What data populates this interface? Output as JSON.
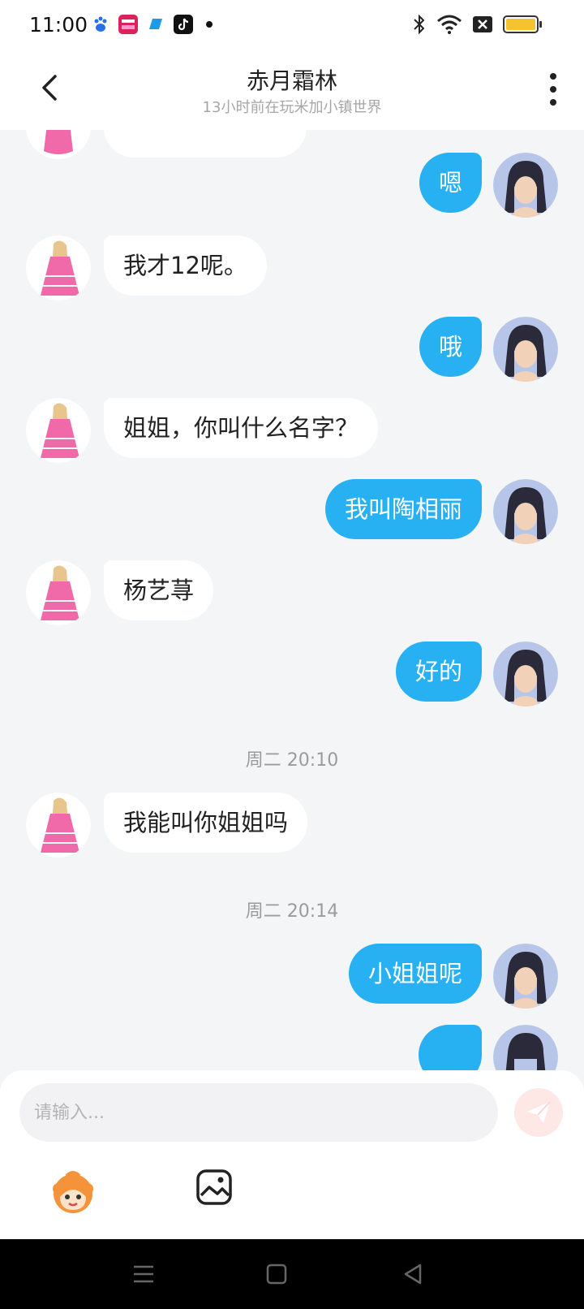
{
  "status_bar": {
    "time": "11:00",
    "app_icons": [
      "baidu-icon",
      "tv-app-icon",
      "blue-app-icon",
      "tiktok-icon"
    ],
    "battery_color": "#f5c330"
  },
  "header": {
    "title": "赤月霜林",
    "subtitle": "13小时前在玩米加小镇世界"
  },
  "messages": [
    {
      "side": "out",
      "text": "嗯"
    },
    {
      "side": "in",
      "text": "我才12呢。"
    },
    {
      "side": "out",
      "text": "哦"
    },
    {
      "side": "in",
      "text": "姐姐，你叫什么名字？"
    },
    {
      "side": "out",
      "text": "我叫陶相丽"
    },
    {
      "side": "in",
      "text": "杨艺荨"
    },
    {
      "side": "out",
      "text": "好的"
    },
    {
      "type": "time",
      "text": "周二 20:10"
    },
    {
      "side": "in",
      "text": "我能叫你姐姐吗"
    },
    {
      "type": "time",
      "text": "周二 20:14"
    },
    {
      "side": "out",
      "text": "小姐姐呢"
    }
  ],
  "input": {
    "placeholder": "请输入..."
  },
  "colors": {
    "outgoing_bubble": "#27b0f2",
    "incoming_bubble": "#ffffff",
    "background": "#f4f5f7",
    "send_button": "#fde8e6"
  }
}
